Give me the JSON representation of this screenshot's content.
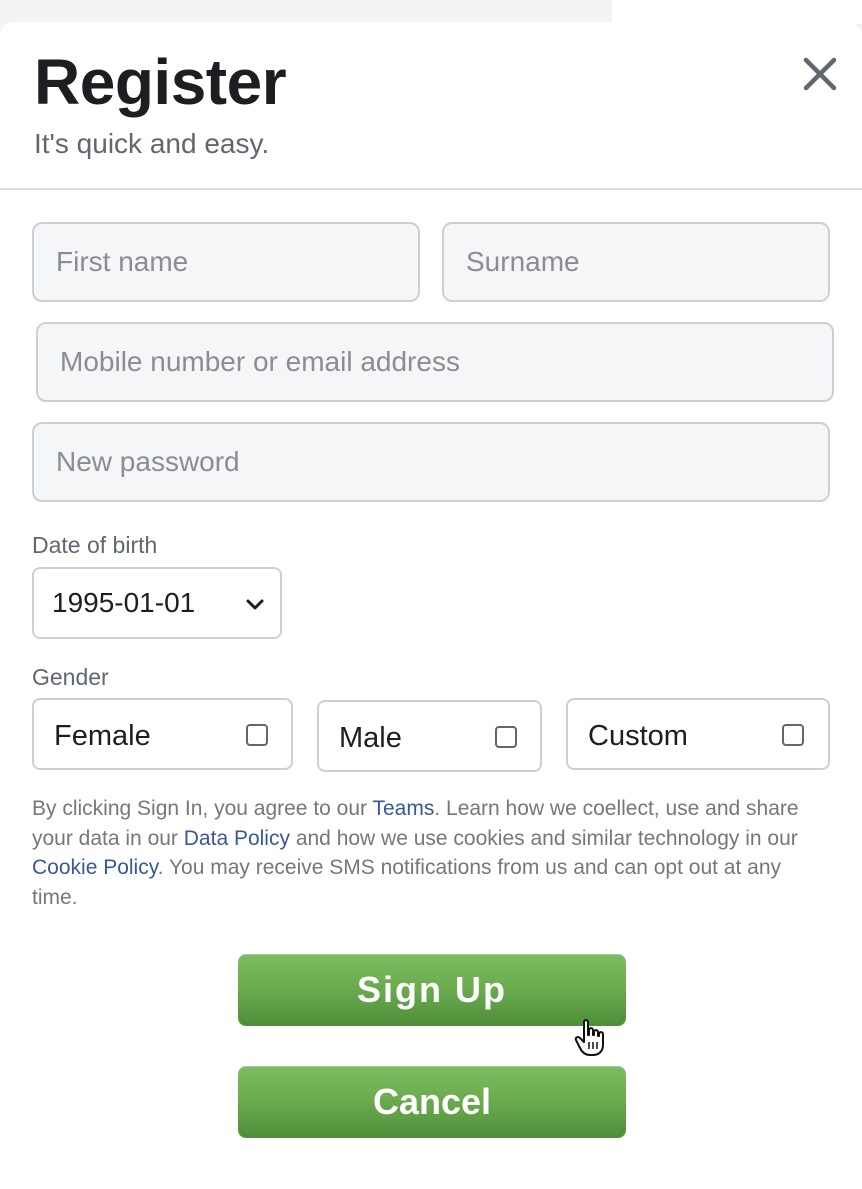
{
  "header": {
    "title": "Register",
    "subtitle": "It's quick and easy."
  },
  "form": {
    "first_name": {
      "placeholder": "First name",
      "value": ""
    },
    "surname": {
      "placeholder": "Surname",
      "value": ""
    },
    "contact": {
      "placeholder": "Mobile number or email address",
      "value": ""
    },
    "password": {
      "placeholder": "New password",
      "value": ""
    },
    "dob_label": "Date of birth",
    "dob_value": "1995-01-01",
    "gender_label": "Gender",
    "gender_options": [
      {
        "label": "Female",
        "checked": false
      },
      {
        "label": "Male",
        "checked": false
      },
      {
        "label": "Custom",
        "checked": false
      }
    ]
  },
  "terms": {
    "part1": "By clicking Sign In, you agree to our ",
    "link1": "Teams",
    "part2": ". Learn how we coellect, use and share your data in our ",
    "link2": "Data Policy",
    "part3": " and how we use cookies and similar technology in our ",
    "link3": "Cookie Policy",
    "part4": ". You may receive SMS notifications from us and can opt out at any time."
  },
  "buttons": {
    "signup_label": "Sign Up",
    "cancel_label": "Cancel"
  },
  "icons": {
    "close": "close-icon",
    "chevron": "chevron-down-icon",
    "cursor": "hand-pointer-cursor-icon"
  },
  "colors": {
    "button_green": "#6aaa4d",
    "link_blue": "#385898",
    "field_bg": "#f5f6f7",
    "field_border": "#ccd0d5"
  }
}
